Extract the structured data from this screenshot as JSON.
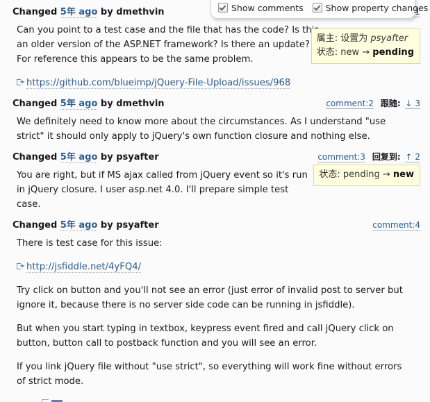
{
  "prefs": {
    "show_comments_label": "Show comments",
    "show_comments_checked": true,
    "show_property_changes_label": "Show property changes",
    "show_property_changes_checked": true
  },
  "colors": {
    "link": "#2c5b8f",
    "propbox_bg": "#ffffe0",
    "propbox_border": "#d8d8a8",
    "page_bg": "#fbfbfb"
  },
  "changes": [
    {
      "changed_word": "Changed",
      "time": "5年 ago",
      "by_word": "by",
      "author": "dmethvin",
      "comment_ref": "comment:1",
      "relation_word": "",
      "relation_ref": "",
      "properties": [
        {
          "name": "属主:",
          "value_prefix": "设置为",
          "value_italic": "psyafter",
          "old": "",
          "arrow": "",
          "new": ""
        },
        {
          "name": "状态:",
          "value_prefix": "",
          "value_italic": "",
          "old": "new",
          "arrow": "→",
          "new": "pending"
        }
      ],
      "paragraphs": [
        "Can you point to a test case and the file that has the code? Is this an older version of the ASP.NET framework? Is there an update? For reference this appears to be the same problem."
      ],
      "link": "https://github.com/blueimp/jQuery-File-Upload/issues/968"
    },
    {
      "changed_word": "Changed",
      "time": "5年 ago",
      "by_word": "by",
      "author": "dmethvin",
      "comment_ref": "comment:2",
      "relation_word": "跟随:",
      "relation_ref": "↓ 3",
      "properties": [],
      "paragraphs": [
        "We definitely need to know more about the circumstances. As I understand \"use strict\" it should only apply to jQuery's own function closure and nothing else."
      ],
      "link": ""
    },
    {
      "changed_word": "Changed",
      "time": "5年 ago",
      "by_word": "by",
      "author": "psyafter",
      "comment_ref": "comment:3",
      "relation_word": "回复到:",
      "relation_ref": "↑ 2",
      "properties": [
        {
          "name": "状态:",
          "value_prefix": "",
          "value_italic": "",
          "old": "pending",
          "arrow": "→",
          "new": "new"
        }
      ],
      "paragraphs": [
        "You are right, but if MS ajax called from jQuery event so it's run in jQuery closure. I user asp.net 4.0. I'll prepare simple test case."
      ],
      "link": ""
    },
    {
      "changed_word": "Changed",
      "time": "5年 ago",
      "by_word": "by",
      "author": "psyafter",
      "comment_ref": "comment:4",
      "relation_word": "",
      "relation_ref": "",
      "properties": [],
      "paragraphs": [
        "There is test case for this issue:"
      ],
      "link": "http://jsfiddle.net/4yFQ4/",
      "paragraphs_after": [
        "Try click on button and you'll not see an error (just error of invalid post to server but ignore it, because there is no server side code can be running in jsfiddle).",
        "But when you start typing in textbox, keypress event fired and call jQuery click on button, button call to postback function and you will see an error.",
        "If you link jQuery file without \"use strict\", so everything will work fine without errors of strict mode."
      ]
    }
  ]
}
